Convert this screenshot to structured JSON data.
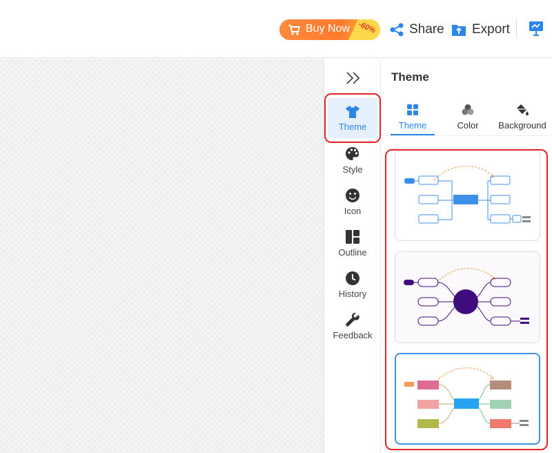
{
  "topbar": {
    "buy_label": "Buy Now",
    "discount": "-60%",
    "share_label": "Share",
    "export_label": "Export"
  },
  "sidebar": {
    "items": [
      {
        "label": "Theme",
        "icon": "tshirt-icon",
        "active": true
      },
      {
        "label": "Style",
        "icon": "palette-icon"
      },
      {
        "label": "Icon",
        "icon": "smiley-icon"
      },
      {
        "label": "Outline",
        "icon": "outline-icon"
      },
      {
        "label": "History",
        "icon": "clock-icon"
      },
      {
        "label": "Feedback",
        "icon": "wrench-icon"
      }
    ]
  },
  "panel": {
    "title": "Theme",
    "tabs": [
      {
        "label": "Theme",
        "icon": "grid-icon",
        "active": true
      },
      {
        "label": "Color",
        "icon": "color-dots-icon"
      },
      {
        "label": "Background",
        "icon": "paint-bucket-icon"
      }
    ]
  },
  "colors": {
    "accent": "#2b86ec",
    "highlight_outline": "#e02424",
    "theme1": "#3d8fe8",
    "theme2": "#3f0c7e",
    "theme3_center": "#27a3f0"
  }
}
